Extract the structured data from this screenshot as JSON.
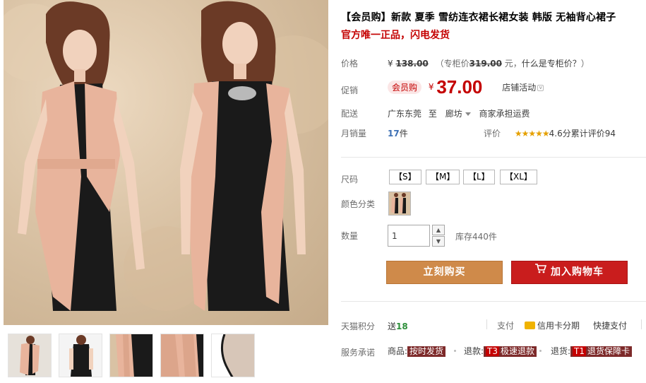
{
  "product": {
    "title": "【会员购】新款 夏季 雪纺连衣裙长裙女装 韩版 无袖背心裙子",
    "subtitle": "官方唯一正品，闪电发货"
  },
  "price": {
    "label": "价格",
    "currency": "¥",
    "original": "138.00",
    "counter_prefix": "（专柜价",
    "counter_price": "319.00",
    "counter_unit": " 元，",
    "counter_link": "什么是专柜价？",
    "counter_suffix": "）"
  },
  "promo": {
    "label": "促销",
    "badge": "会员购",
    "currency": "¥",
    "price": "37.00",
    "store_activity": "店铺活动"
  },
  "shipping": {
    "label": "配送",
    "from": "广东东莞",
    "to_word": "至",
    "to": "廊坊",
    "fee": "商家承担运费"
  },
  "sales": {
    "label": "月销量",
    "count": "17",
    "unit": "件",
    "rating_label": "评价",
    "stars": "★★★★★",
    "score": "4.6分",
    "total_label": "累计评价",
    "total": "94"
  },
  "sizes": {
    "label": "尺码",
    "options": [
      "【S】",
      "【M】",
      "【L】",
      "【XL】"
    ]
  },
  "color": {
    "label": "颜色分类"
  },
  "quantity": {
    "label": "数量",
    "value": "1",
    "up": "▲",
    "down": "▼",
    "stock_prefix": "库存",
    "stock": "440",
    "stock_unit": "件"
  },
  "actions": {
    "buy": "立刻购买",
    "cart": "加入购物车"
  },
  "points": {
    "label": "天猫积分",
    "give": "送",
    "value": "18"
  },
  "payment": {
    "label": "支付",
    "credit": "信用卡分期",
    "express": "快捷支付"
  },
  "service": {
    "label": "服务承诺",
    "goods_prefix": "商品:",
    "goods_tag": "按时发货",
    "refund_prefix": "退款:",
    "refund_code": "T3",
    "refund_tag": "极速退款",
    "return_prefix": "退货:",
    "return_code": "T1",
    "return_tag": "退货保障卡"
  },
  "colors": {
    "price_red": "#c40000",
    "buy_button": "#cf8a4a",
    "cart_button": "#c91d1d",
    "dress_peach": "#e8b49c",
    "dress_black": "#1a1a1a"
  }
}
